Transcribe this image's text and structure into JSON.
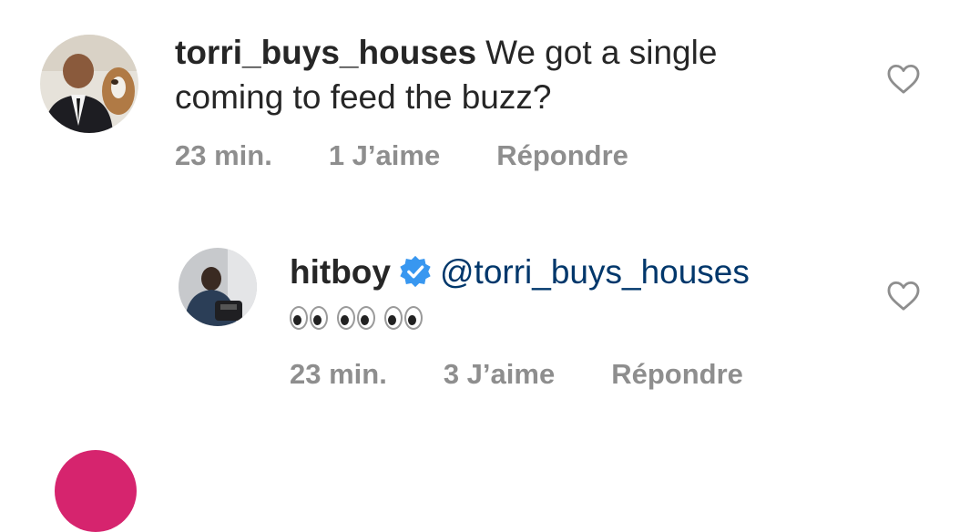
{
  "comments": [
    {
      "username": "torri_buys_houses",
      "text": "We got a single coming to feed the buzz?",
      "time": "23 min.",
      "likes": "1 J’aime",
      "reply": "Répondre"
    },
    {
      "username": "hitboy",
      "verified": true,
      "mention": "@torri_buys_houses",
      "emoji_text": "👀👀👀",
      "time": "23 min.",
      "likes": "3 J’aime",
      "reply": "Répondre"
    }
  ],
  "colors": {
    "text": "#262626",
    "meta": "#8e8e8e",
    "mention": "#00376b",
    "verified": "#3897f0"
  },
  "icons": {
    "like": "heart-outline-icon",
    "verified": "verified-badge-icon"
  }
}
